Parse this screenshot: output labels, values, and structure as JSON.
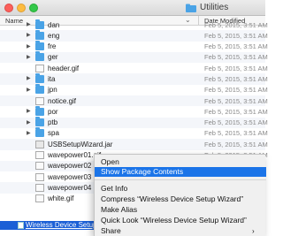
{
  "window": {
    "title": "Utilities"
  },
  "columns": {
    "name": "Name",
    "date_modified": "Date Modified"
  },
  "rows": [
    {
      "name": "dan",
      "date": "Feb 5, 2015, 3:51 AM",
      "kind": "folder"
    },
    {
      "name": "eng",
      "date": "Feb 5, 2015, 3:51 AM",
      "kind": "folder"
    },
    {
      "name": "fre",
      "date": "Feb 5, 2015, 3:51 AM",
      "kind": "folder"
    },
    {
      "name": "ger",
      "date": "Feb 5, 2015, 3:51 AM",
      "kind": "folder"
    },
    {
      "name": "header.gif",
      "date": "Feb 5, 2015, 3:51 AM",
      "kind": "file"
    },
    {
      "name": "ita",
      "date": "Feb 5, 2015, 3:51 AM",
      "kind": "folder"
    },
    {
      "name": "jpn",
      "date": "Feb 5, 2015, 3:51 AM",
      "kind": "folder"
    },
    {
      "name": "notice.gif",
      "date": "Feb 5, 2015, 3:51 AM",
      "kind": "file"
    },
    {
      "name": "por",
      "date": "Feb 5, 2015, 3:51 AM",
      "kind": "folder"
    },
    {
      "name": "ptb",
      "date": "Feb 5, 2015, 3:51 AM",
      "kind": "folder"
    },
    {
      "name": "spa",
      "date": "Feb 5, 2015, 3:51 AM",
      "kind": "folder"
    },
    {
      "name": "USBSetupWizard.jar",
      "date": "Feb 5, 2015, 3:51 AM",
      "kind": "jar"
    },
    {
      "name": "wavepower01.gif",
      "date": "Feb 5, 2015, 3:51 AM",
      "kind": "file"
    },
    {
      "name": "wavepower02",
      "date": "",
      "kind": "file"
    },
    {
      "name": "wavepower03",
      "date": "",
      "kind": "file"
    },
    {
      "name": "wavepower04",
      "date": "",
      "kind": "file"
    },
    {
      "name": "white.gif",
      "date": "",
      "kind": "file"
    }
  ],
  "selected": {
    "name": "Wireless Device Setup"
  },
  "context_menu": {
    "open": "Open",
    "show_package_contents": "Show Package Contents",
    "get_info": "Get Info",
    "compress": "Compress “Wireless Device Setup Wizard”",
    "make_alias": "Make Alias",
    "quick_look": "Quick Look “Wireless Device Setup Wizard”",
    "share": "Share"
  },
  "icons": {
    "folder": "folder-icon",
    "file": "document-icon",
    "disclosure": "disclosure-triangle-icon",
    "share_arrow": "chevron-right-icon"
  },
  "colors": {
    "folder": "#4aa3e6",
    "selection": "#1b5fd6",
    "menu_highlight": "#1b74e8"
  }
}
